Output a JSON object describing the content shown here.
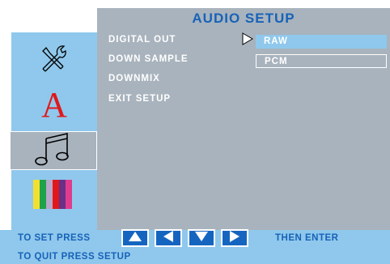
{
  "title": "AUDIO SETUP",
  "sidebar": {
    "items": [
      {
        "name": "tools",
        "icon": "tools-icon"
      },
      {
        "name": "language",
        "icon": "letter-a-icon",
        "glyph": "A"
      },
      {
        "name": "audio",
        "icon": "music-note-icon",
        "selected": true
      },
      {
        "name": "video",
        "icon": "color-bars-icon"
      }
    ]
  },
  "menu": {
    "items": [
      "DIGITAL OUT",
      "DOWN SAMPLE",
      "DOWNMIX",
      "EXIT SETUP"
    ]
  },
  "options": {
    "selected_value": "RAW",
    "items": [
      "RAW",
      "PCM"
    ]
  },
  "bottom": {
    "set_press": "TO SET PRESS",
    "then_enter": "THEN ENTER",
    "quit_press": "TO QUIT PRESS SETUP",
    "nav_buttons": [
      "up-arrow-icon",
      "left-arrow-icon",
      "down-arrow-icon",
      "right-arrow-icon"
    ]
  },
  "colors": {
    "accent": "#1762b8",
    "light_blue": "#8fc8ec",
    "panel_gray": "#a8b3bd",
    "text_white": "#ffffff"
  }
}
